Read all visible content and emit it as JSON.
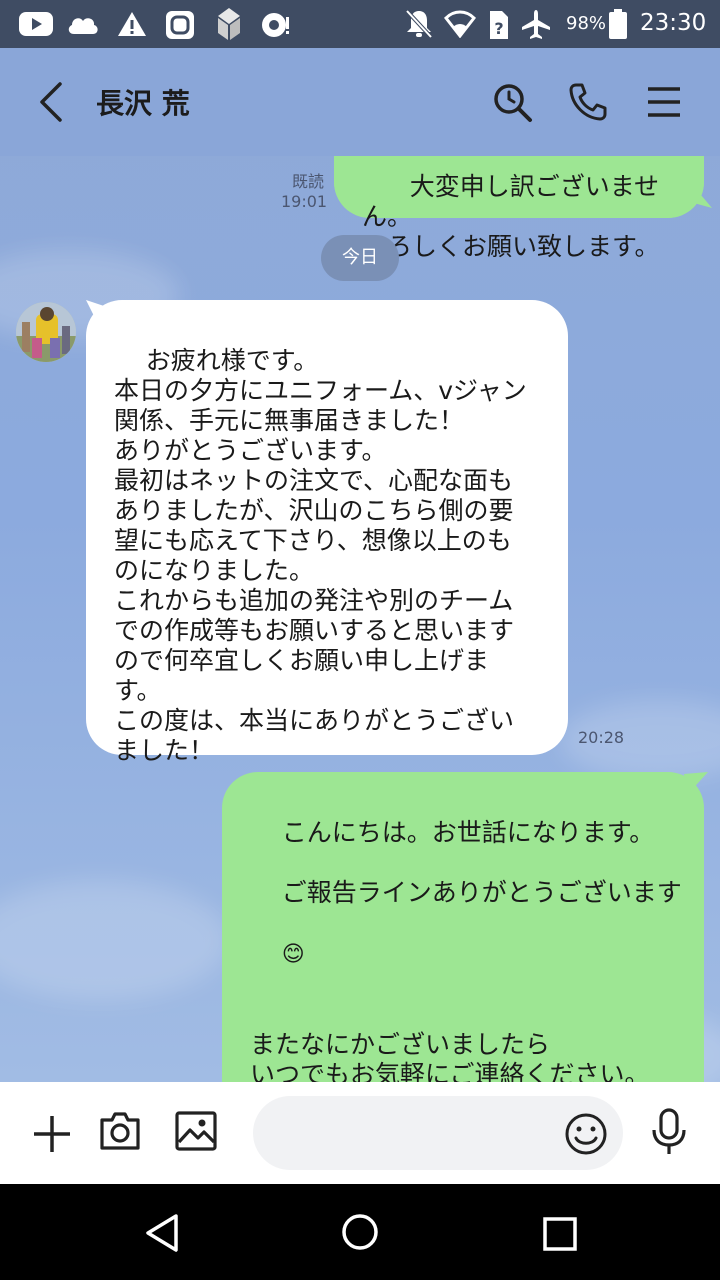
{
  "status_bar": {
    "battery_percent": "98%",
    "time": "23:30",
    "icons": [
      "youtube-icon",
      "cloud-icon",
      "warning-icon",
      "square-app-icon",
      "puzzle-app-icon",
      "radio-app-icon",
      "notifications-off-icon",
      "wifi-icon",
      "no-sim-icon",
      "airplane-mode-icon",
      "battery-icon"
    ]
  },
  "header": {
    "contact_name": "長沢 荒",
    "icons": [
      "back-icon",
      "search-icon",
      "call-icon",
      "menu-icon"
    ]
  },
  "chat": {
    "previous_message": {
      "text": "大変申し訳ございません。\nよろしくお願い致します。",
      "read_label": "既読",
      "time": "19:01"
    },
    "day_separator": "今日",
    "incoming_message": {
      "text": "お疲れ様です。\n本日の夕方にユニフォーム、vジャン\n関係、手元に無事届きました！\nありがとうございます。\n最初はネットの注文で、心配な面も\nありましたが、沢山のこちら側の要\n望にも応えて下さり、想像以上のも\nのになりました。\nこれからも追加の発注や別のチーム\nでの作成等もお願いすると思います\nので何卒宜しくお願い申し上げま\nす。\nこの度は、本当にありがとうござい\nました！",
      "time": "20:28"
    },
    "outgoing_message": {
      "line1": "こんにちは。お世話になります。",
      "line2": "ご報告ラインありがとうございます",
      "emoji": "😊",
      "rest": "\nまたなにかございましたら\nいつでもお気軽にご連絡ください。\n\n状態確認してみてまた何かございま\nしたら\nご連絡宜しくお願い致します。"
    }
  },
  "input_bar": {
    "placeholder": "",
    "icons": [
      "plus-icon",
      "camera-icon",
      "image-icon",
      "emoji-icon",
      "microphone-icon"
    ]
  },
  "nav_bar": {
    "icons": [
      "nav-back-icon",
      "nav-home-icon",
      "nav-recents-icon"
    ]
  },
  "colors": {
    "status_bar": "#3f4c63",
    "chat_background": "#8caade",
    "outgoing_bubble": "#9de693",
    "incoming_bubble": "#ffffff"
  }
}
